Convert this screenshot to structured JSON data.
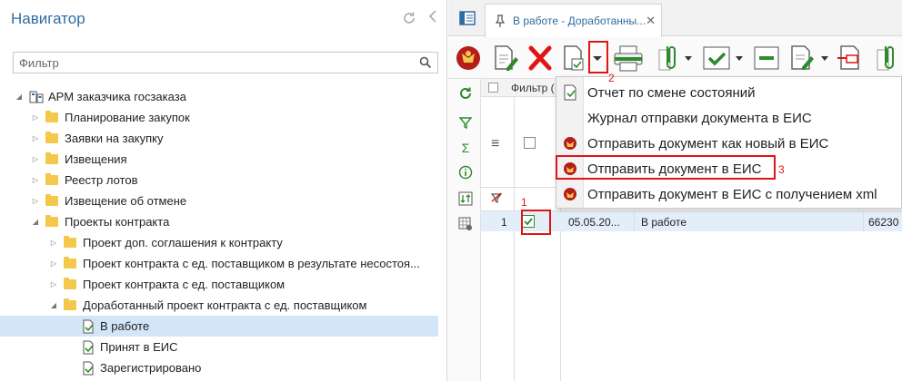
{
  "navigator": {
    "title": "Навигатор",
    "filter_placeholder": "Фильтр",
    "tree": [
      {
        "label": "АРМ заказчика госзаказа",
        "level": 0,
        "expanded": true,
        "type": "root"
      },
      {
        "label": "Планирование закупок",
        "level": 1,
        "expanded": false,
        "type": "folder"
      },
      {
        "label": "Заявки на закупку",
        "level": 1,
        "expanded": false,
        "type": "folder"
      },
      {
        "label": "Извещения",
        "level": 1,
        "expanded": false,
        "type": "folder"
      },
      {
        "label": "Реестр лотов",
        "level": 1,
        "expanded": false,
        "type": "folder"
      },
      {
        "label": "Извещение об отмене",
        "level": 1,
        "expanded": false,
        "type": "folder"
      },
      {
        "label": "Проекты контракта",
        "level": 1,
        "expanded": true,
        "type": "folder"
      },
      {
        "label": "Проект доп. соглашения к контракту",
        "level": 2,
        "expanded": false,
        "type": "folder"
      },
      {
        "label": "Проект контракта с ед. поставщиком в результате несостоя...",
        "level": 2,
        "expanded": false,
        "type": "folder"
      },
      {
        "label": "Проект контракта с ед. поставщиком",
        "level": 2,
        "expanded": false,
        "type": "folder"
      },
      {
        "label": "Доработанный проект контракта с ед. поставщиком",
        "level": 2,
        "expanded": true,
        "type": "folder"
      },
      {
        "label": "В работе",
        "level": 3,
        "type": "doc",
        "selected": true
      },
      {
        "label": "Принят в ЕИС",
        "level": 3,
        "type": "doc"
      },
      {
        "label": "Зарегистрировано",
        "level": 3,
        "type": "doc"
      }
    ]
  },
  "tabs": {
    "active_label": "В работе - Доработанны..."
  },
  "grid": {
    "filter_label": "Фильтр (",
    "row": {
      "num": "1",
      "date": "05.05.20...",
      "status": "В работе",
      "code": "66230"
    }
  },
  "menu": {
    "items": [
      {
        "label": "Отчет по смене состояний",
        "icon": "report-icon"
      },
      {
        "label": "Журнал отправки документа в ЕИС",
        "icon": ""
      },
      {
        "label": "Отправить документ как новый в ЕИС",
        "icon": "emblem-icon"
      },
      {
        "label": "Отправить документ в ЕИС",
        "icon": "emblem-icon"
      },
      {
        "label": "Отправить документ в ЕИС с получением xml",
        "icon": "emblem-icon"
      }
    ]
  },
  "annotations": {
    "n1": "1",
    "n2": "2",
    "n3": "3"
  },
  "colors": {
    "accent": "#2d6da3",
    "selection": "#d3e6f8",
    "annotation": "#e01414",
    "folder": "#f4c84a"
  }
}
